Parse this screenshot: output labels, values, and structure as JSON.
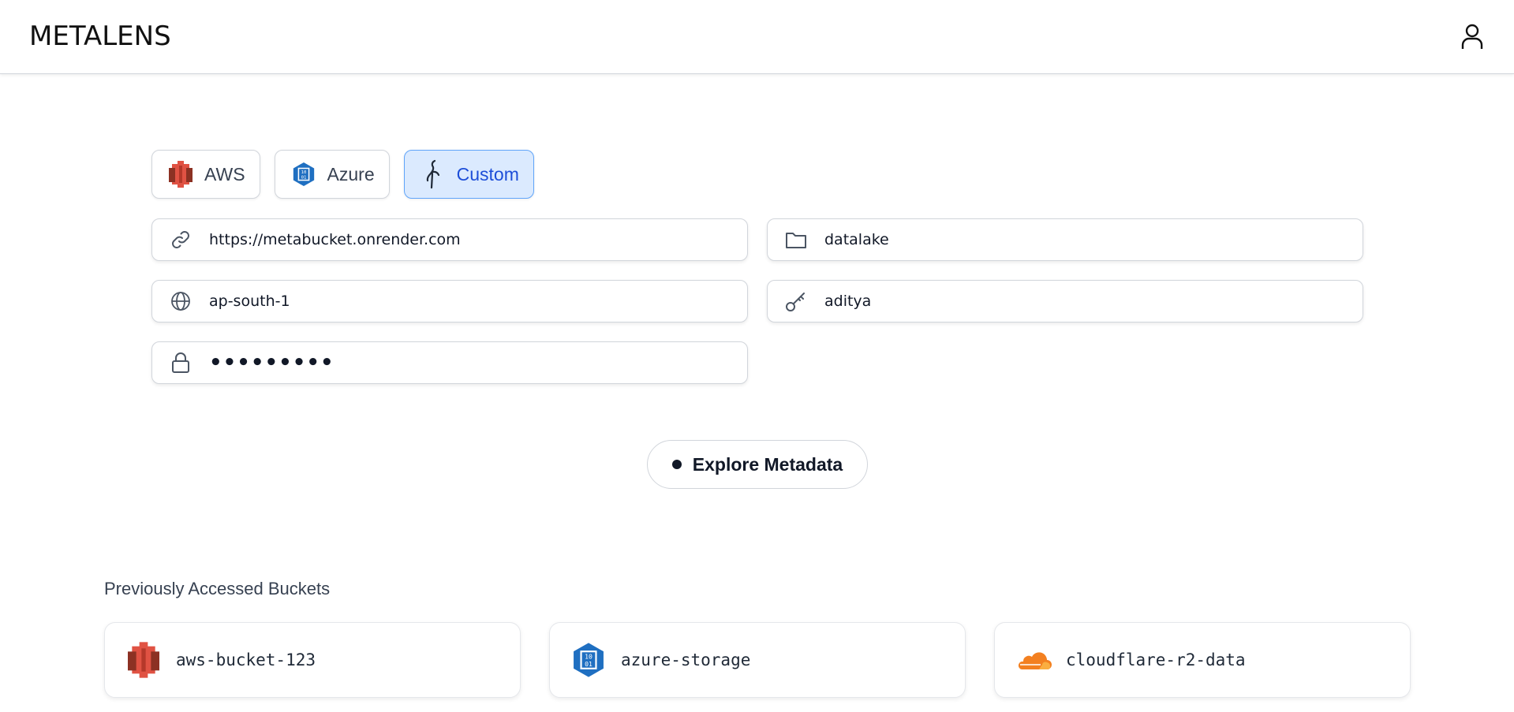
{
  "app": {
    "title": "METALENS"
  },
  "header": {
    "user_icon": "user-icon"
  },
  "providers": [
    {
      "label": "AWS",
      "icon": "aws-s3-icon",
      "active": false
    },
    {
      "label": "Azure",
      "icon": "azure-storage-icon",
      "active": false
    },
    {
      "label": "Custom",
      "icon": "minio-bird-icon",
      "active": true
    }
  ],
  "form": {
    "endpoint": {
      "icon": "link-icon",
      "value": "https://metabucket.onrender.com"
    },
    "bucket": {
      "icon": "folder-icon",
      "value": "datalake"
    },
    "region": {
      "icon": "globe-icon",
      "value": "ap-south-1"
    },
    "access_key": {
      "icon": "key-icon",
      "value": "aditya"
    },
    "secret_key": {
      "icon": "lock-icon",
      "value": "•••••••••"
    }
  },
  "explore_button": {
    "label": "Explore Metadata"
  },
  "previous": {
    "title": "Previously Accessed Buckets",
    "buckets": [
      {
        "name": "aws-bucket-123",
        "icon": "aws-s3-icon"
      },
      {
        "name": "azure-storage",
        "icon": "azure-storage-icon"
      },
      {
        "name": "cloudflare-r2-data",
        "icon": "cloudflare-icon"
      }
    ]
  },
  "colors": {
    "accent": "#1d4ed8",
    "active_tab_bg": "#dbeafe",
    "aws": "#c7452c",
    "azure": "#1f6fc1",
    "cloudflare": "#f38020"
  }
}
